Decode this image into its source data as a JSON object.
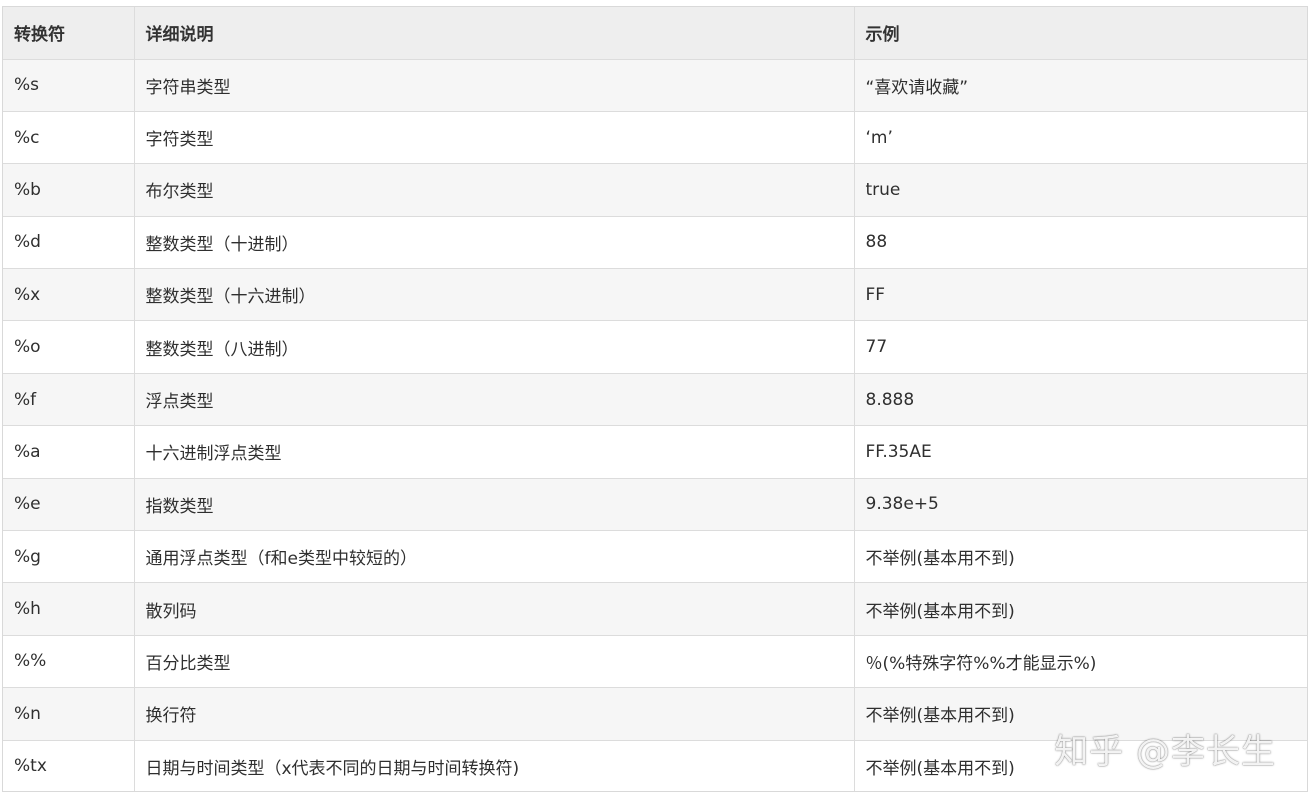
{
  "table": {
    "headers": [
      "转换符",
      "详细说明",
      "示例"
    ],
    "rows": [
      [
        "%s",
        "字符串类型",
        "“喜欢请收藏”"
      ],
      [
        "%c",
        "字符类型",
        "‘m’"
      ],
      [
        "%b",
        "布尔类型",
        "true"
      ],
      [
        "%d",
        "整数类型（十进制）",
        "88"
      ],
      [
        "%x",
        "整数类型（十六进制）",
        "FF"
      ],
      [
        "%o",
        "整数类型（八进制）",
        "77"
      ],
      [
        "%f",
        "浮点类型",
        "8.888"
      ],
      [
        "%a",
        "十六进制浮点类型",
        "FF.35AE"
      ],
      [
        "%e",
        "指数类型",
        "9.38e+5"
      ],
      [
        "%g",
        "通用浮点类型（f和e类型中较短的）",
        "不举例(基本用不到)"
      ],
      [
        "%h",
        "散列码",
        "不举例(基本用不到)"
      ],
      [
        "%%",
        "百分比类型",
        "％(%特殊字符%%才能显示%)"
      ],
      [
        "%n",
        "换行符",
        "不举例(基本用不到)"
      ],
      [
        "%tx",
        "日期与时间类型（x代表不同的日期与时间转换符)",
        "不举例(基本用不到)"
      ]
    ]
  },
  "watermark": "知乎 @李长生"
}
